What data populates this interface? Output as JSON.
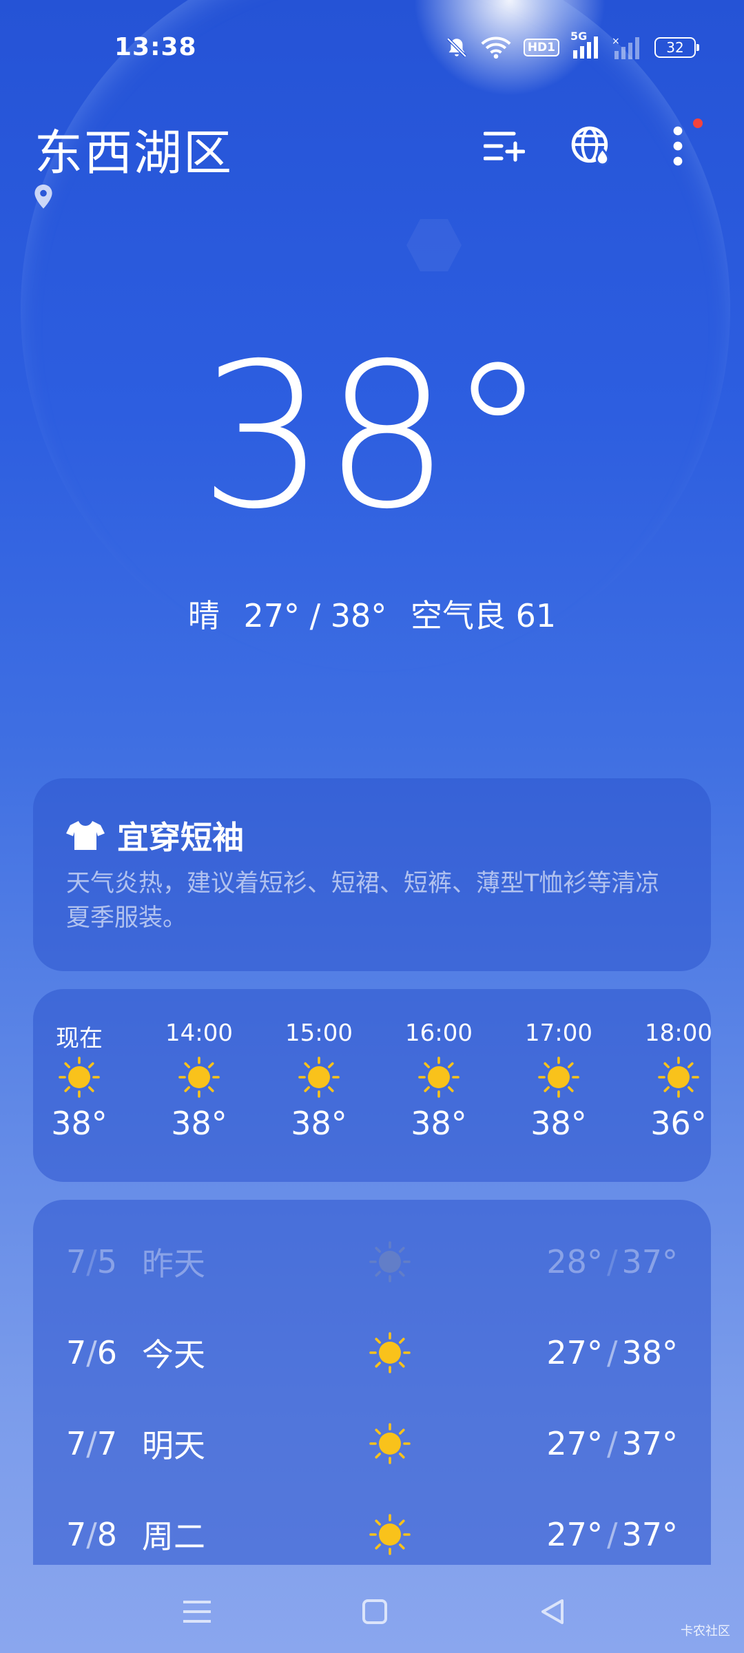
{
  "status_bar": {
    "time": "13:38",
    "network_label": "5G",
    "hd_label": "HD1",
    "battery": "32"
  },
  "header": {
    "city": "东西湖区"
  },
  "current": {
    "temperature": "38°",
    "condition": "晴",
    "range": "27° / 38°",
    "air_quality": "空气良 61"
  },
  "dress_card": {
    "title": "宜穿短袖",
    "text": "天气炎热，建议着短衫、短裙、短裤、薄型T恤衫等清凉夏季服装。"
  },
  "hourly": [
    {
      "label": "现在",
      "temp": "38°",
      "icon": "sun-icon"
    },
    {
      "label": "14:00",
      "temp": "38°",
      "icon": "sun-icon"
    },
    {
      "label": "15:00",
      "temp": "38°",
      "icon": "sun-icon"
    },
    {
      "label": "16:00",
      "temp": "38°",
      "icon": "sun-icon"
    },
    {
      "label": "17:00",
      "temp": "38°",
      "icon": "sun-icon"
    },
    {
      "label": "18:00",
      "temp": "36°",
      "icon": "sun-icon"
    }
  ],
  "daily": [
    {
      "month": "7",
      "day": "5",
      "name": "昨天",
      "low": "28°",
      "high": "37°",
      "icon": "sun-icon"
    },
    {
      "month": "7",
      "day": "6",
      "name": "今天",
      "low": "27°",
      "high": "38°",
      "icon": "sun-icon"
    },
    {
      "month": "7",
      "day": "7",
      "name": "明天",
      "low": "27°",
      "high": "37°",
      "icon": "sun-icon"
    },
    {
      "month": "7",
      "day": "8",
      "name": "周二",
      "low": "27°",
      "high": "37°",
      "icon": "sun-icon"
    }
  ],
  "watermark": "卡农社区",
  "colors": {
    "sun": "#f9c21b",
    "sun_past": "#8f97a8",
    "notification_dot": "#f4433c"
  }
}
